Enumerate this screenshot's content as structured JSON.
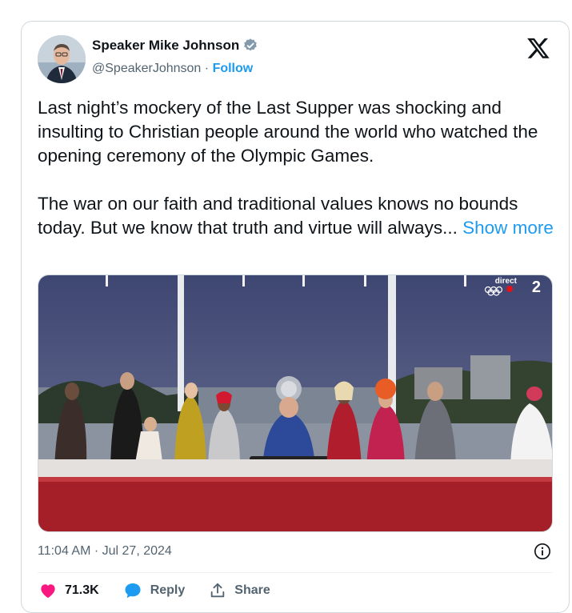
{
  "author": {
    "name": "Speaker Mike Johnson",
    "handle": "@SpeakerJohnson",
    "separator": "·",
    "follow_label": "Follow",
    "verified_color": "#829aab"
  },
  "post": {
    "paragraphs": [
      "Last night’s mockery of the Last Supper was shocking and insulting to Christian people around the world who watched the opening ceremony of the Olympic Games.",
      "The war on our faith and traditional values knows no bounds today. But we know that truth and virtue will always..."
    ],
    "show_more_label": "Show more",
    "media": {
      "broadcast_label": "direct",
      "channel_number": "2"
    },
    "timestamp": "11:04 AM · Jul 27, 2024"
  },
  "actions": {
    "likes_count": "71.3K",
    "reply_label": "Reply",
    "share_label": "Share"
  },
  "colors": {
    "accent": "#1d9bf0",
    "like": "#f91880",
    "text": "#0f1419",
    "secondary": "#536471"
  },
  "icons": [
    "verified-badge-icon",
    "x-logo-icon",
    "info-icon",
    "heart-icon",
    "reply-bubble-icon",
    "share-icon",
    "olympic-rings-icon"
  ]
}
